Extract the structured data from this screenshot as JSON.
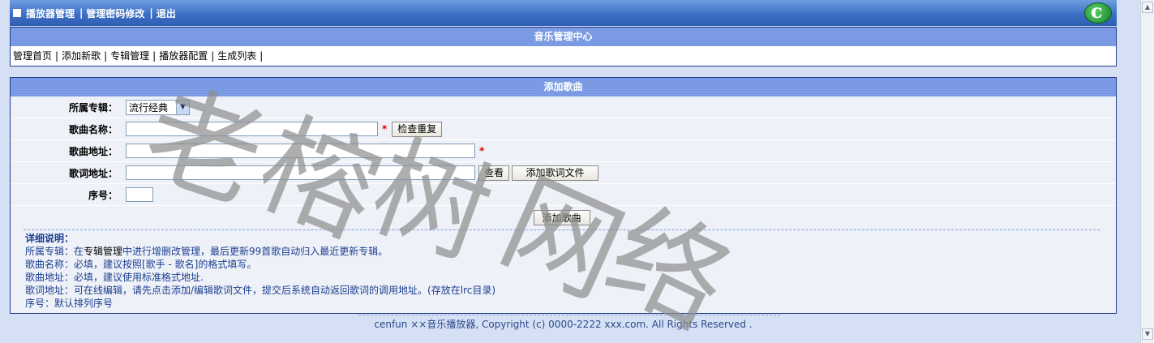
{
  "topnav": {
    "player_manage": "播放器管理",
    "password_change": "管理密码修改",
    "logout": "退出",
    "separator": "|"
  },
  "center_title": "音乐管理中心",
  "submenu": {
    "items": [
      {
        "label": "管理首页"
      },
      {
        "label": "添加新歌"
      },
      {
        "label": "专辑管理"
      },
      {
        "label": "播放器配置"
      },
      {
        "label": "生成列表",
        "color": "#c00000"
      }
    ],
    "separator": "|"
  },
  "form": {
    "title": "添加歌曲",
    "album_label": "所属专辑：",
    "album_value": "流行经典",
    "song_name_label": "歌曲名称：",
    "song_name_value": "",
    "required_mark": "*",
    "check_duplicate_btn": "检查重复",
    "song_url_label": "歌曲地址：",
    "song_url_value": "",
    "lyric_url_label": "歌词地址：",
    "lyric_url_value": "",
    "view_btn": "查看",
    "add_lyric_btn": "添加歌词文件",
    "order_label": "序号：",
    "order_value": "",
    "submit_btn": "添加歌曲"
  },
  "notes": {
    "heading": "详细说明：",
    "line1_prefix": "所属专辑：在",
    "line1_link": "专辑管理",
    "line1_suffix": "中进行增删改管理，最后更新99首歌自动归入最近更新专辑。",
    "line2": "歌曲名称：必填，建议按照[歌手 - 歌名]的格式填写。",
    "line3": "歌曲地址：必填，建议使用标准格式地址.",
    "line4": "歌词地址：可在线编辑，请先点击添加/编辑歌词文件，提交后系统自动返回歌词的调用地址。(存放在lrc目录)",
    "line5": "序号：默认排列序号"
  },
  "footer": "cenfun ××音乐播放器, Copyright (c) 0000-2222 xxx.com. All Rights Reserved .",
  "watermark": "老榕树网络",
  "colors": {
    "topbar": "#3c6fc4",
    "titlebar": "#7f9fe6",
    "accent_red": "#c00000",
    "notes_text": "#1c3f8f"
  }
}
